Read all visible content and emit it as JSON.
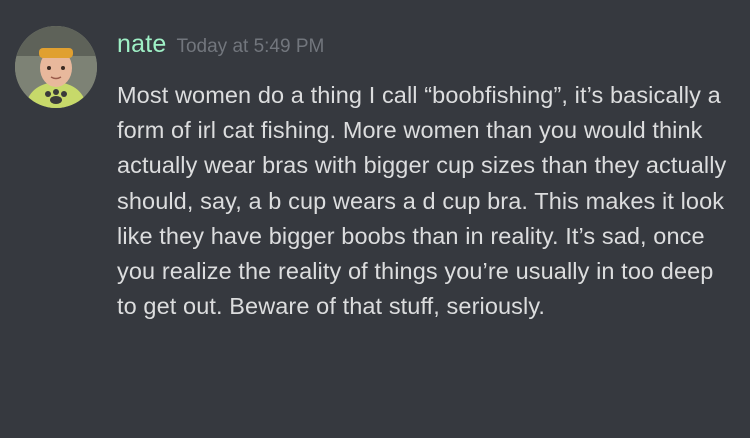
{
  "message": {
    "username": "nate",
    "timestamp": "Today at 5:49 PM",
    "text": "Most women do a thing I call “boobfishing”, it’s basically a form of irl cat fishing. More women than you would think actually wear bras with bigger cup sizes than they actually should, say, a b cup wears a d cup bra. This makes it look like they have bigger boobs than in reality. It’s sad, once you realize the reality of things you’re usually in too deep to get out. Beware of that stuff, seriously.",
    "avatar_icon": "user-avatar"
  },
  "colors": {
    "background": "#36393f",
    "username": "#9ff0c6",
    "timestamp": "#72767d",
    "text": "#dcddde"
  }
}
